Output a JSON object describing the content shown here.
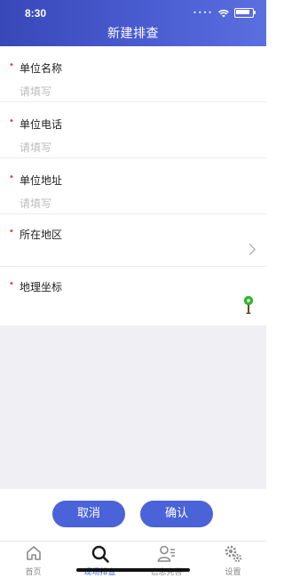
{
  "status": {
    "time": "8:30"
  },
  "header": {
    "title": "新建排查"
  },
  "form": {
    "required_mark": "•",
    "fields": [
      {
        "label": "单位名称",
        "placeholder": "请填写"
      },
      {
        "label": "单位电话",
        "placeholder": "请填写"
      },
      {
        "label": "单位地址",
        "placeholder": "请填写"
      },
      {
        "label": "所在地区"
      },
      {
        "label": "地理坐标"
      }
    ]
  },
  "actions": {
    "cancel_label": "取消",
    "confirm_label": "确认"
  },
  "tabs": [
    {
      "label": "首页",
      "icon": "home-icon",
      "active": false
    },
    {
      "label": "现场排查",
      "icon": "search-icon",
      "active": true
    },
    {
      "label": "信息完善",
      "icon": "user-edit-icon",
      "active": false
    },
    {
      "label": "设置",
      "icon": "gear-icon",
      "active": false
    }
  ],
  "colors": {
    "accent": "#4a63d8",
    "required": "#e33333",
    "pin": "#2eb82e"
  }
}
